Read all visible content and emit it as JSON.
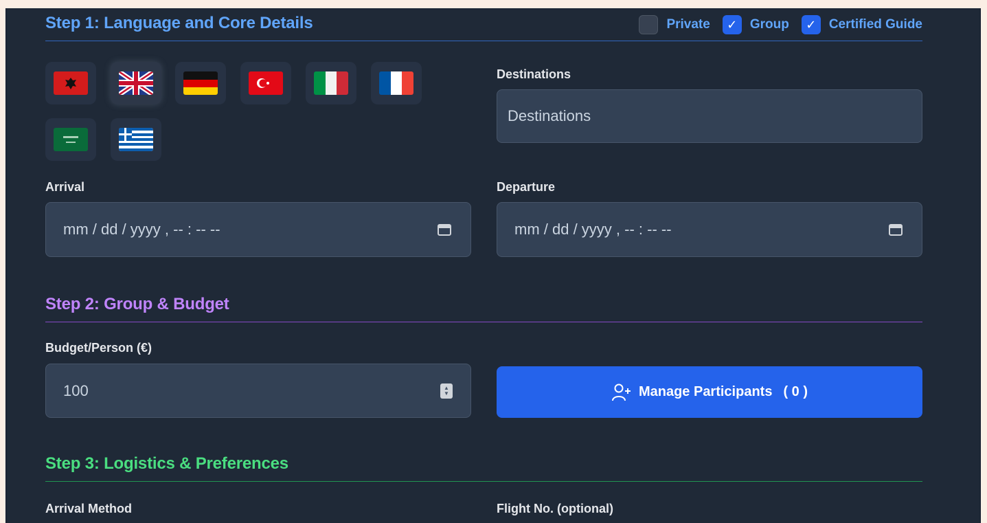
{
  "step1": {
    "title": "Step 1: Language and Core Details",
    "checkboxes": [
      {
        "label": "Private",
        "checked": false
      },
      {
        "label": "Group",
        "checked": true
      },
      {
        "label": "Certified Guide",
        "checked": true
      }
    ],
    "languages": [
      {
        "icon": "albania-flag-icon",
        "selected": false
      },
      {
        "icon": "uk-flag-icon",
        "selected": true
      },
      {
        "icon": "germany-flag-icon",
        "selected": false
      },
      {
        "icon": "turkey-flag-icon",
        "selected": false
      },
      {
        "icon": "italy-flag-icon",
        "selected": false
      },
      {
        "icon": "france-flag-icon",
        "selected": false
      },
      {
        "icon": "saudi-arabia-flag-icon",
        "selected": false
      },
      {
        "icon": "greece-flag-icon",
        "selected": false
      }
    ],
    "destinations_label": "Destinations",
    "destinations_placeholder": "Destinations",
    "arrival_label": "Arrival",
    "arrival_placeholder": "mm / dd / yyyy ,  -- : --  --",
    "departure_label": "Departure",
    "departure_placeholder": "mm / dd / yyyy ,  -- : --  --"
  },
  "step2": {
    "title": "Step 2: Group & Budget",
    "budget_label": "Budget/Person (€)",
    "budget_value": "100",
    "manage_label": "Manage Participants",
    "participant_count": "( 0 )"
  },
  "step3": {
    "title": "Step 3: Logistics & Preferences",
    "arrival_method_label": "Arrival Method",
    "flight_label": "Flight No. (optional)"
  },
  "colors": {
    "page_bg": "#fbeee4",
    "panel_bg": "#1f2937",
    "field_bg": "#334155",
    "accent_blue": "#2563eb",
    "step1_color": "#60a5fa",
    "step2_color": "#c084fc",
    "step3_color": "#4ade80"
  }
}
